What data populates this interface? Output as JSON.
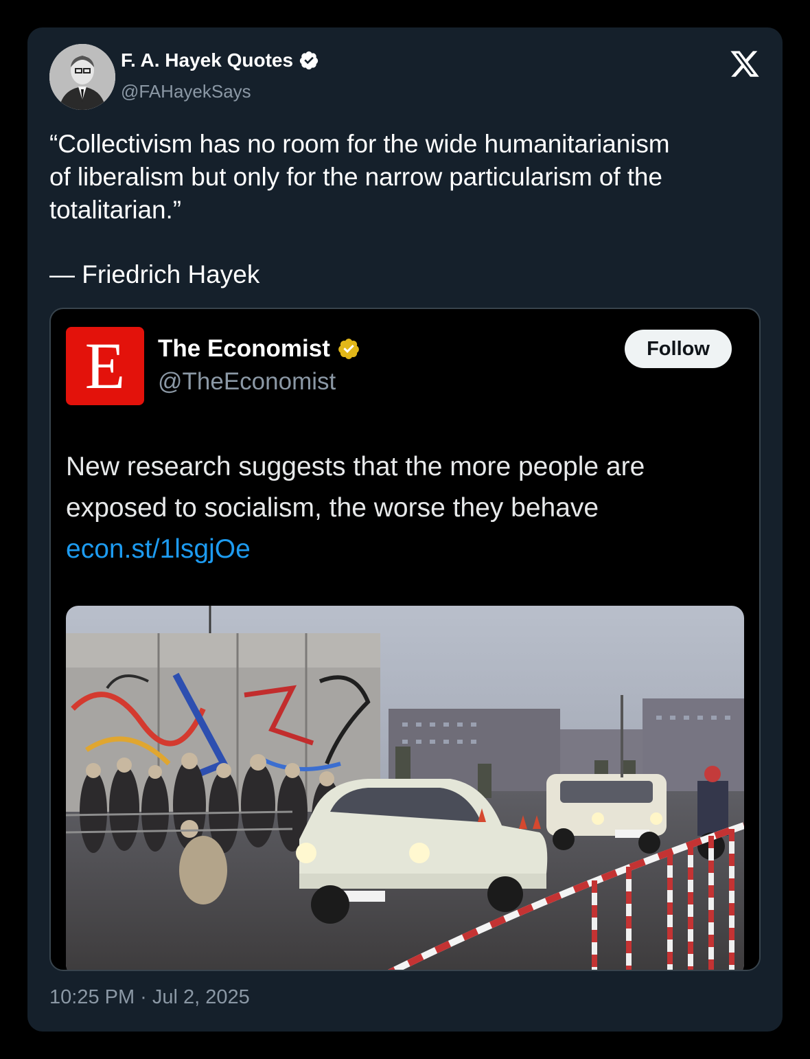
{
  "tweet": {
    "author_name": "F. A. Hayek Quotes",
    "author_handle": "@FAHayekSays",
    "text": "“Collectivism has no room for the wide humanitarianism\nof liberalism but only for the narrow particularism of the\ntotalitarian.”",
    "attribution": "— Friedrich Hayek",
    "timestamp": "10:25 PM · Jul 2, 2025"
  },
  "quoted": {
    "logo_letter": "E",
    "author_name": "The Economist",
    "author_handle": "@TheEconomist",
    "follow_label": "Follow",
    "text": "New research suggests that the more people are exposed to socialism, the worse they behave",
    "link": "econ.st/1lsgjOe"
  },
  "icons": {
    "close": "x-logo-icon",
    "verified_author": "verified-badge-icon",
    "verified_quoted": "verified-gold-badge-icon"
  },
  "colors": {
    "card_bg": "#15202b",
    "quote_bg": "#000000",
    "link": "#1d9bf0",
    "economist_red": "#e3120b",
    "verified_gold": "#e2b719",
    "muted_text": "#8b98a5"
  }
}
